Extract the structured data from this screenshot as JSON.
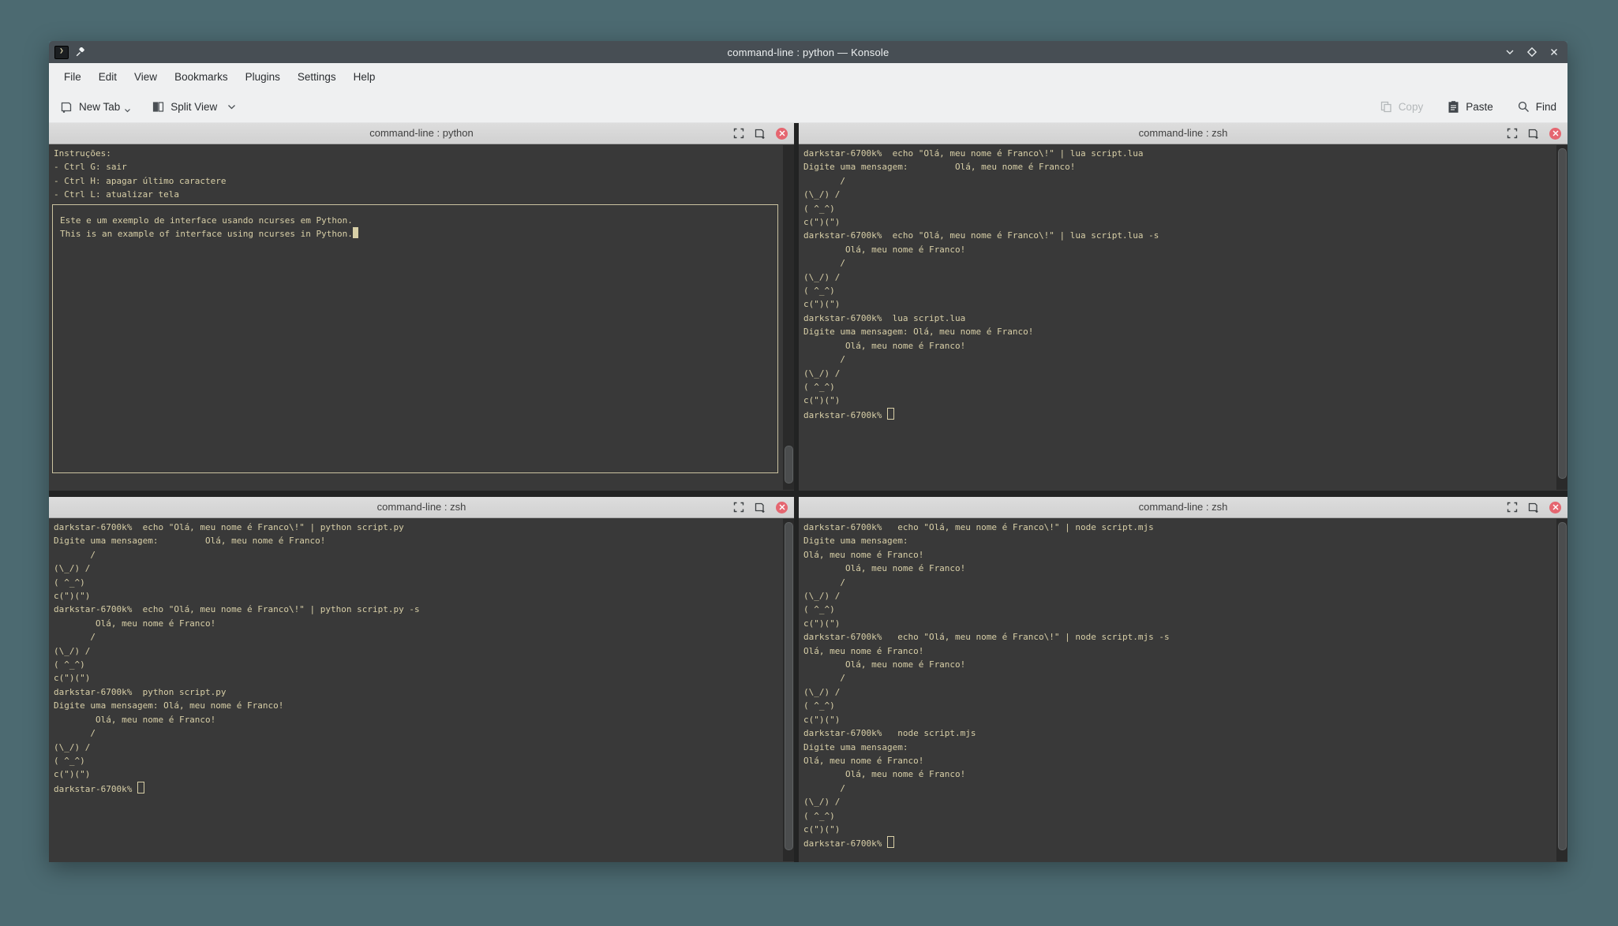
{
  "window": {
    "title": "command-line : python — Konsole"
  },
  "menubar": {
    "items": [
      "File",
      "Edit",
      "View",
      "Bookmarks",
      "Plugins",
      "Settings",
      "Help"
    ]
  },
  "toolbar": {
    "new_tab": "New Tab",
    "split_view": "Split View",
    "copy": "Copy",
    "paste": "Paste",
    "find": "Find"
  },
  "icons": [
    "konsole-icon",
    "pin-icon",
    "minimize-icon",
    "maximize-icon",
    "close-icon",
    "new-tab-icon",
    "split-view-icon",
    "chevron-down-icon",
    "copy-icon",
    "paste-icon",
    "search-icon",
    "expand-split-icon",
    "detach-split-icon",
    "close-split-icon"
  ],
  "colors": {
    "desktop": "#4c6a71",
    "titlebar": "#474e54",
    "chrome": "#eff0f1",
    "pane_header": "#d7d7d7",
    "terminal_bg": "#393939",
    "terminal_fg": "#d8cfa7",
    "close_red": "#e56670"
  },
  "panes": [
    {
      "title": "command-line : python",
      "intro_lines": [
        "Instruções:",
        "- Ctrl G: sair",
        "- Ctrl H: apagar último caractere",
        "- Ctrl L: atualizar tela"
      ],
      "box_line_1": "Este e um exemplo de interface usando ncurses em Python.",
      "box_line_2": "This is an example of interface using ncurses in Python."
    },
    {
      "title": "command-line : zsh",
      "lines": [
        "darkstar-6700k%  echo \"Olá, meu nome é Franco\\!\" | lua script.lua",
        "Digite uma mensagem:         Olá, meu nome é Franco!",
        "       /",
        "(\\_/) /",
        "( ^_^)",
        "c(\")(\")",
        "darkstar-6700k%  echo \"Olá, meu nome é Franco\\!\" | lua script.lua -s",
        "        Olá, meu nome é Franco!",
        "       /",
        "(\\_/) /",
        "( ^_^)",
        "c(\")(\")",
        "darkstar-6700k%  lua script.lua",
        "Digite uma mensagem: Olá, meu nome é Franco!",
        "        Olá, meu nome é Franco!",
        "       /",
        "(\\_/) /",
        "( ^_^)",
        "c(\")(\")"
      ],
      "prompt": "darkstar-6700k%"
    },
    {
      "title": "command-line : zsh",
      "lines": [
        "darkstar-6700k%  echo \"Olá, meu nome é Franco\\!\" | python script.py",
        "Digite uma mensagem:         Olá, meu nome é Franco!",
        "       /",
        "(\\_/) /",
        "( ^_^)",
        "c(\")(\")",
        "darkstar-6700k%  echo \"Olá, meu nome é Franco\\!\" | python script.py -s",
        "        Olá, meu nome é Franco!",
        "       /",
        "(\\_/) /",
        "( ^_^)",
        "c(\")(\")",
        "darkstar-6700k%  python script.py",
        "Digite uma mensagem: Olá, meu nome é Franco!",
        "        Olá, meu nome é Franco!",
        "       /",
        "(\\_/) /",
        "( ^_^)",
        "c(\")(\")"
      ],
      "prompt": "darkstar-6700k%"
    },
    {
      "title": "command-line : zsh",
      "lines": [
        "darkstar-6700k%   echo \"Olá, meu nome é Franco\\!\" | node script.mjs",
        "Digite uma mensagem:",
        "Olá, meu nome é Franco!",
        "        Olá, meu nome é Franco!",
        "       /",
        "(\\_/) /",
        "( ^_^)",
        "c(\")(\")",
        "darkstar-6700k%   echo \"Olá, meu nome é Franco\\!\" | node script.mjs -s",
        "Olá, meu nome é Franco!",
        "        Olá, meu nome é Franco!",
        "       /",
        "(\\_/) /",
        "( ^_^)",
        "c(\")(\")",
        "darkstar-6700k%   node script.mjs",
        "Digite uma mensagem:",
        "Olá, meu nome é Franco!",
        "        Olá, meu nome é Franco!",
        "       /",
        "(\\_/) /",
        "( ^_^)",
        "c(\")(\")"
      ],
      "prompt": "darkstar-6700k%"
    }
  ]
}
